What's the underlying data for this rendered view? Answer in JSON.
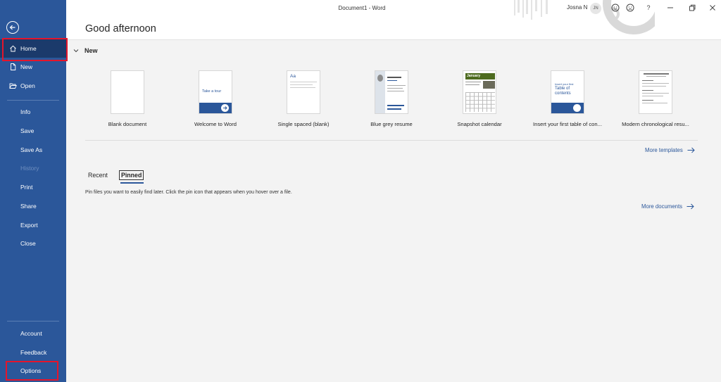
{
  "titlebar": {
    "doc_title": "Document1 - Word",
    "user_name": "Josna N",
    "avatar_initials": "JN",
    "icons": [
      "smiley-icon",
      "frown-icon",
      "help-icon",
      "minimize-icon",
      "restore-icon",
      "close-icon"
    ],
    "help_label": "?"
  },
  "sidebar": {
    "top_items": [
      {
        "label": "Home",
        "icon": "home-icon"
      },
      {
        "label": "New",
        "icon": "new-doc-icon"
      },
      {
        "label": "Open",
        "icon": "folder-open-icon"
      }
    ],
    "mid_items": [
      {
        "label": "Info"
      },
      {
        "label": "Save"
      },
      {
        "label": "Save As"
      },
      {
        "label": "History"
      },
      {
        "label": "Print"
      },
      {
        "label": "Share"
      },
      {
        "label": "Export"
      },
      {
        "label": "Close"
      }
    ],
    "bottom_items": [
      {
        "label": "Account"
      },
      {
        "label": "Feedback"
      },
      {
        "label": "Options"
      }
    ]
  },
  "main": {
    "greeting": "Good afternoon",
    "new_section_title": "New",
    "templates": [
      {
        "label": "Blank document"
      },
      {
        "label": "Welcome to Word",
        "thumb_text": "Take a tour"
      },
      {
        "label": "Single spaced (blank)",
        "thumb_text": "Aa"
      },
      {
        "label": "Blue grey resume"
      },
      {
        "label": "Snapshot calendar",
        "thumb_text": "January"
      },
      {
        "label": "Insert your first table of con...",
        "thumb_text_1": "Insert your first",
        "thumb_text_2": "Table of",
        "thumb_text_3": "contents"
      },
      {
        "label": "Modern chronological resu..."
      }
    ],
    "more_templates": "More templates",
    "tabs": [
      {
        "label": "Recent"
      },
      {
        "label": "Pinned"
      }
    ],
    "pinned_hint": "Pin files you want to easily find later. Click the pin icon that appears when you hover over a file.",
    "more_documents": "More documents"
  },
  "colors": {
    "accent": "#2b579a",
    "sidebar_active": "#1b3a6b",
    "highlight": "#e5152b"
  }
}
